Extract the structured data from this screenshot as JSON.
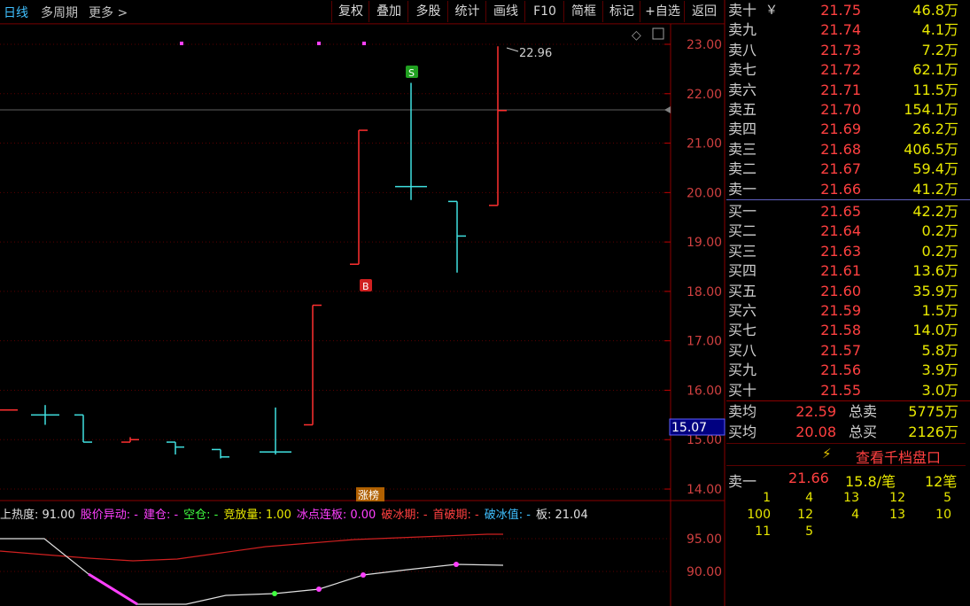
{
  "toolbar": {
    "period": "日线",
    "multi_period": "多周期",
    "more": "更多",
    "buttons": [
      "复权",
      "叠加",
      "多股",
      "统计",
      "画线",
      "F10",
      "简框",
      "标记",
      "+自选",
      "返回"
    ]
  },
  "chart": {
    "price_labels": [
      "23.00",
      "22.00",
      "21.00",
      "20.00",
      "19.00",
      "18.00",
      "17.00",
      "16.00",
      "15.00",
      "14.00"
    ],
    "current_price_tag": "15.07",
    "high_annotation": "22.96",
    "buy_marker": "B",
    "sell_marker": "S",
    "event_label": "涨榜",
    "indicator_labels": [
      "95.00",
      "90.00"
    ],
    "candles": [
      {
        "o": 15.6,
        "h": 15.6,
        "l": 15.6,
        "c": 15.6,
        "color": "red"
      },
      {
        "o": 15.5,
        "h": 15.7,
        "l": 15.3,
        "c": 15.5,
        "color": "cyan"
      },
      {
        "o": 15.5,
        "h": 15.5,
        "l": 14.95,
        "c": 14.95,
        "color": "cyan"
      },
      {
        "o": 14.95,
        "h": 15.05,
        "l": 14.9,
        "c": 15.0,
        "color": "red"
      },
      {
        "o": 14.95,
        "h": 14.95,
        "l": 14.7,
        "c": 14.85,
        "color": "cyan"
      },
      {
        "o": 14.8,
        "h": 14.8,
        "l": 14.62,
        "c": 14.65,
        "color": "cyan"
      },
      {
        "o": 14.75,
        "h": 15.65,
        "l": 14.7,
        "c": 14.75,
        "color": "cyan"
      },
      {
        "o": 15.3,
        "h": 17.72,
        "l": 14.95,
        "c": 17.72,
        "color": "red"
      },
      {
        "o": 18.55,
        "h": 21.26,
        "l": 18.3,
        "c": 21.26,
        "color": "red"
      },
      {
        "o": 20.12,
        "h": 22.22,
        "l": 19.85,
        "c": 20.12,
        "color": "cyan"
      },
      {
        "o": 19.82,
        "h": 19.82,
        "l": 18.38,
        "c": 19.12,
        "color": "cyan"
      },
      {
        "o": 19.74,
        "h": 22.96,
        "l": 19.74,
        "c": 21.66,
        "color": "red"
      }
    ]
  },
  "indicator_bar": [
    {
      "text": "上热度: 91.00",
      "color": "#e0e0e0"
    },
    {
      "text": "股价异动: -",
      "color": "#ff40ff"
    },
    {
      "text": "建仓: -",
      "color": "#ff40ff"
    },
    {
      "text": "空仓: -",
      "color": "#40ff40"
    },
    {
      "text": "竞放量: 1.00",
      "color": "#e8e800"
    },
    {
      "text": "冰点连板: 0.00",
      "color": "#ff40ff"
    },
    {
      "text": "破冰期: -",
      "color": "#ff4040"
    },
    {
      "text": "首破期: -",
      "color": "#ff4040"
    },
    {
      "text": "破冰值: -",
      "color": "#40c0ff"
    },
    {
      "text": "板: 21.04",
      "color": "#e0e0e0"
    }
  ],
  "orderbook": {
    "asks": [
      {
        "label": "卖十",
        "price": "21.75",
        "vol": "46.8万"
      },
      {
        "label": "卖九",
        "price": "21.74",
        "vol": "4.1万"
      },
      {
        "label": "卖八",
        "price": "21.73",
        "vol": "7.2万"
      },
      {
        "label": "卖七",
        "price": "21.72",
        "vol": "62.1万"
      },
      {
        "label": "卖六",
        "price": "21.71",
        "vol": "11.5万"
      },
      {
        "label": "卖五",
        "price": "21.70",
        "vol": "154.1万"
      },
      {
        "label": "卖四",
        "price": "21.69",
        "vol": "26.2万"
      },
      {
        "label": "卖三",
        "price": "21.68",
        "vol": "406.5万"
      },
      {
        "label": "卖二",
        "price": "21.67",
        "vol": "59.4万"
      },
      {
        "label": "卖一",
        "price": "21.66",
        "vol": "41.2万"
      }
    ],
    "bids": [
      {
        "label": "买一",
        "price": "21.65",
        "vol": "42.2万"
      },
      {
        "label": "买二",
        "price": "21.64",
        "vol": "0.2万"
      },
      {
        "label": "买三",
        "price": "21.63",
        "vol": "0.2万"
      },
      {
        "label": "买四",
        "price": "21.61",
        "vol": "13.6万"
      },
      {
        "label": "买五",
        "price": "21.60",
        "vol": "35.9万"
      },
      {
        "label": "买六",
        "price": "21.59",
        "vol": "1.5万"
      },
      {
        "label": "买七",
        "price": "21.58",
        "vol": "14.0万"
      },
      {
        "label": "买八",
        "price": "21.57",
        "vol": "5.8万"
      },
      {
        "label": "买九",
        "price": "21.56",
        "vol": "3.9万"
      },
      {
        "label": "买十",
        "price": "21.55",
        "vol": "3.0万"
      }
    ],
    "currency_mark": "￥",
    "ask_avg_label": "卖均",
    "ask_avg": "22.59",
    "total_sell_label": "总卖",
    "total_sell": "5775万",
    "bid_avg_label": "买均",
    "bid_avg": "20.08",
    "total_buy_label": "总买",
    "total_buy": "2126万",
    "view_depth": "查看千档盘口",
    "first_ask_label": "卖一",
    "first_ask_price": "21.66",
    "first_ask_ratio": "15.8/笔",
    "first_ask_count": "12笔",
    "ticks": [
      [
        "1",
        "4",
        "13",
        "12",
        "5"
      ],
      [
        "100",
        "12",
        "4",
        "13",
        "10"
      ],
      [
        "11",
        "5"
      ]
    ]
  }
}
